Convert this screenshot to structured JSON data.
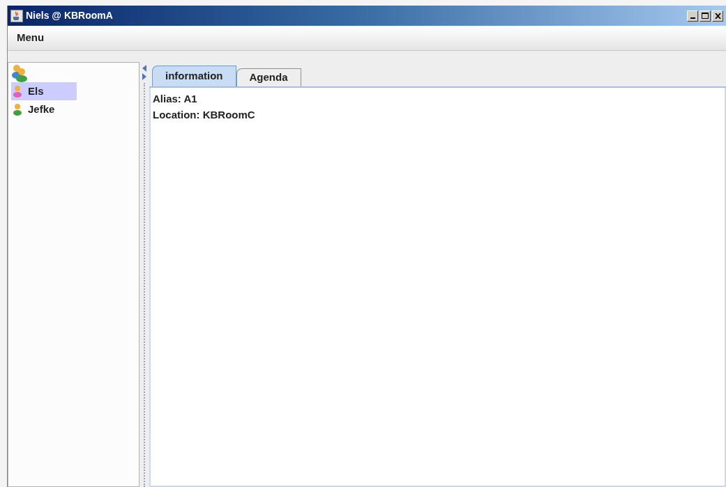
{
  "window": {
    "title": "Niels @ KBRoomA"
  },
  "menu_bar": {
    "items": [
      "Menu"
    ]
  },
  "contacts": {
    "children": [
      {
        "name": "Els",
        "selected": true,
        "color": "#e060c0"
      },
      {
        "name": "Jefke",
        "selected": false,
        "color": "#40a040"
      }
    ]
  },
  "tabs": [
    {
      "label": "information",
      "selected": true
    },
    {
      "label": "Agenda",
      "selected": false
    }
  ],
  "info_lines": [
    "Alias: A1",
    "Location: KBRoomC"
  ]
}
